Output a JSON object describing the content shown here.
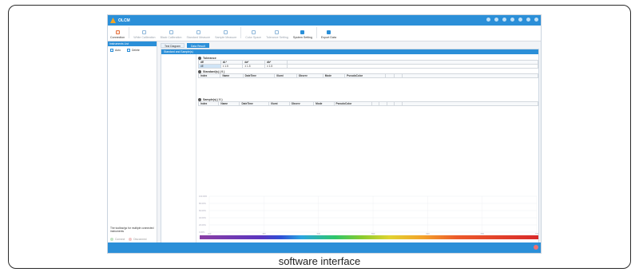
{
  "app": {
    "title": "OLCM"
  },
  "toolbar": {
    "items": [
      {
        "label": "Connection",
        "state": "active"
      },
      {
        "label": "White Calibration",
        "state": "disabled"
      },
      {
        "label": "Black Calibration",
        "state": "disabled"
      },
      {
        "label": "Standard Measure",
        "state": "disabled"
      },
      {
        "label": "Sample Measure",
        "state": "disabled"
      },
      {
        "label": "Color Space",
        "state": "disabled"
      },
      {
        "label": "Tolerance Setting",
        "state": "disabled"
      },
      {
        "label": "System Setting",
        "state": "enabled"
      },
      {
        "label": "Export Data",
        "state": "enabled"
      }
    ]
  },
  "sidebar": {
    "header": "Instruments List",
    "select_all": "Auto",
    "delete": "Delete",
    "note": "The toolbar/go for multiple connected instruments",
    "foot_connect": "Connect",
    "foot_disconnect": "Disconnect"
  },
  "tabs": [
    {
      "label": "Test Diagram",
      "active": false
    },
    {
      "label": "Data Result",
      "active": true
    }
  ],
  "panel_header": "Standard and Sample(s)",
  "tolerance": {
    "title": "Tolerance",
    "headers": [
      "dE",
      "dL*",
      "da*",
      "db*"
    ],
    "row": [
      "dE",
      "± 1.5",
      "± 1.5",
      "± 1.5"
    ]
  },
  "standard": {
    "title": "Standard(s) ( 0 )",
    "headers": [
      "Index",
      "Name",
      "DateTime",
      "Illumi",
      "Observ",
      "Mode",
      "PseudoColor"
    ]
  },
  "sample": {
    "title": "Sample(s) ( 0 )",
    "headers": [
      "Index",
      "Name",
      "DateTime",
      "Illumi",
      "Observ",
      "Mode",
      "PseudoColor"
    ]
  },
  "chart_axis": {
    "y_ticks": [
      "100.00%",
      "80.00%",
      "60.00%",
      "40.00%",
      "20.00%",
      "0.00%"
    ],
    "x_ticks": [
      "400",
      "450",
      "500",
      "550",
      "600",
      "650",
      "700"
    ]
  },
  "caption": "software interface",
  "colors": {
    "accent": "#2b8fd8",
    "active_icon": "#e57340"
  }
}
